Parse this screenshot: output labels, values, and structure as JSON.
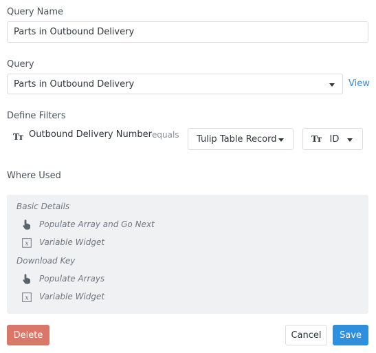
{
  "query_name": {
    "label": "Query Name",
    "value": "Parts in Outbound Delivery"
  },
  "query": {
    "label": "Query",
    "selected": "Parts in Outbound Delivery",
    "view_link": "View"
  },
  "filters": {
    "label": "Define Filters",
    "rows": [
      {
        "type_icon": "Tт",
        "field": "Outbound Delivery Number",
        "operator": "equals",
        "source": "Tulip Table Record",
        "target_icon": "Tт",
        "target": "ID"
      }
    ]
  },
  "where_used": {
    "label": "Where Used",
    "sections": [
      {
        "title": "Basic Details",
        "items": [
          {
            "icon": "hand-pointer-icon",
            "label": "Populate Array and Go Next"
          },
          {
            "icon": "variable-widget-icon",
            "label": "Variable Widget"
          }
        ]
      },
      {
        "title": "Download Key",
        "items": [
          {
            "icon": "hand-pointer-icon",
            "label": "Populate Arrays"
          },
          {
            "icon": "variable-widget-icon",
            "label": "Variable Widget"
          }
        ]
      }
    ]
  },
  "footer": {
    "delete": "Delete",
    "cancel": "Cancel",
    "save": "Save"
  },
  "colors": {
    "accent": "#2f8fdc",
    "danger": "#d9776a",
    "panel": "#f0f1f3"
  }
}
